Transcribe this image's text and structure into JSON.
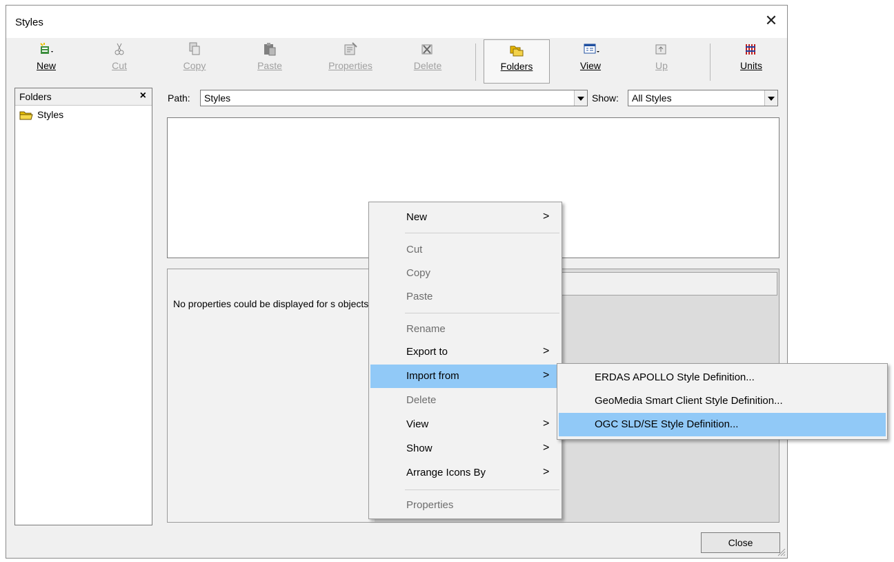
{
  "window": {
    "title": "Styles",
    "close_glyph": "✕"
  },
  "toolbar": {
    "new": "New",
    "cut": "Cut",
    "copy": "Copy",
    "paste": "Paste",
    "properties": "Properties",
    "delete": "Delete",
    "folders": "Folders",
    "view": "View",
    "up": "Up",
    "units": "Units"
  },
  "folders_pane": {
    "title": "Folders",
    "close_glyph": "×",
    "tree": [
      "Styles"
    ]
  },
  "path": {
    "label": "Path:",
    "value": "Styles"
  },
  "show": {
    "label": "Show:",
    "value": "All Styles"
  },
  "properties_panel": {
    "message": "No properties could be displayed for s objects."
  },
  "close_button": "Close",
  "context_menu": {
    "items": [
      {
        "label": "New",
        "submenu": true,
        "enabled": true
      },
      {
        "label": "Cut",
        "enabled": false
      },
      {
        "label": "Copy",
        "enabled": false
      },
      {
        "label": "Paste",
        "enabled": false
      },
      {
        "label": "Rename",
        "enabled": false
      },
      {
        "label": "Export to",
        "submenu": true,
        "enabled": true
      },
      {
        "label": "Import from",
        "submenu": true,
        "enabled": true,
        "highlighted": true
      },
      {
        "label": "Delete",
        "enabled": false
      },
      {
        "label": "View",
        "submenu": true,
        "enabled": true
      },
      {
        "label": "Show",
        "submenu": true,
        "enabled": true
      },
      {
        "label": "Arrange Icons By",
        "submenu": true,
        "enabled": true
      },
      {
        "label": "Properties",
        "enabled": false
      }
    ],
    "arrow_glyph": ">"
  },
  "import_submenu": {
    "items": [
      {
        "label": "ERDAS APOLLO Style Definition..."
      },
      {
        "label": "GeoMedia Smart Client Style Definition..."
      },
      {
        "label": "OGC SLD/SE Style Definition...",
        "highlighted": true
      }
    ]
  },
  "colors": {
    "highlight": "#91c9f7",
    "dialog_bg": "#f0f0f0",
    "disabled_text": "#6d6d6d"
  }
}
